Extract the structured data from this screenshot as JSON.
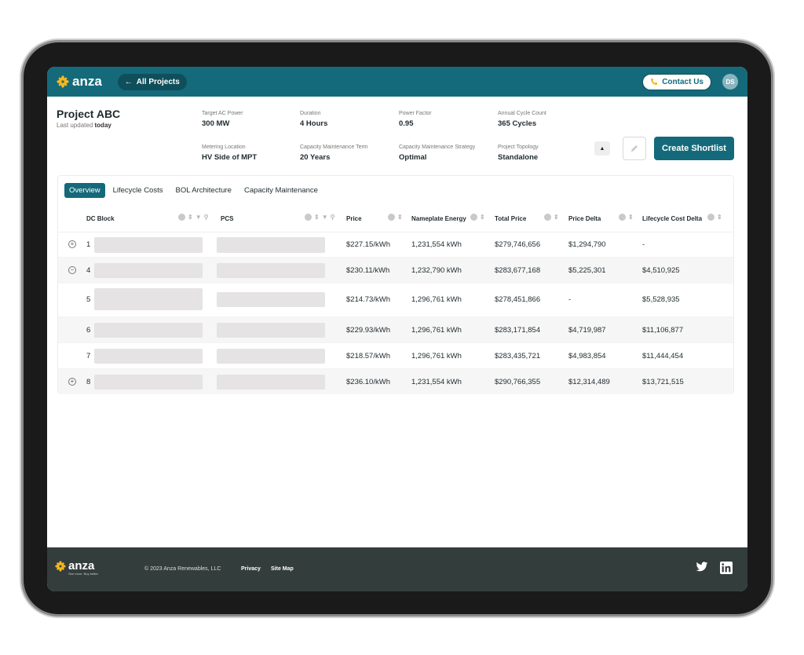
{
  "nav": {
    "logo_text": "anza",
    "back_label": "All Projects",
    "contact_label": "Contact Us",
    "avatar_initials": "DS"
  },
  "project": {
    "title": "Project ABC",
    "updated_prefix": "Last updated",
    "updated_value": "today",
    "meta": [
      {
        "label": "Target AC Power",
        "value": "300 MW"
      },
      {
        "label": "Duration",
        "value": "4 Hours"
      },
      {
        "label": "Power Factor",
        "value": "0.95"
      },
      {
        "label": "Annual Cycle Count",
        "value": "365 Cycles"
      },
      {
        "label": "Metering Location",
        "value": "HV Side of MPT"
      },
      {
        "label": "Capacity Maintenance Term",
        "value": "20 Years"
      },
      {
        "label": "Capacity Maintenance Strategy",
        "value": "Optimal"
      },
      {
        "label": "Project Topology",
        "value": "Standalone"
      }
    ],
    "shortlist_label": "Create Shortlist"
  },
  "tabs": [
    "Overview",
    "Lifecycle Costs",
    "BOL Architecture",
    "Capacity Maintenance"
  ],
  "table": {
    "columns": [
      "DC Block",
      "PCS",
      "Price",
      "Nameplate Energy",
      "Total Price",
      "Price Delta",
      "Lifecycle Cost Delta"
    ],
    "rows": [
      {
        "expander": "+",
        "id": "1",
        "price": "$227.15/kWh",
        "energy": "1,231,554 kWh",
        "total": "$279,746,656",
        "delta": "$1,294,790",
        "lifecycle": "-"
      },
      {
        "expander": "−",
        "id": "4",
        "price": "$230.11/kWh",
        "energy": "1,232,790 kWh",
        "total": "$283,677,168",
        "delta": "$5,225,301",
        "lifecycle": "$4,510,925"
      },
      {
        "expander": "",
        "id": "5",
        "price": "$214.73/kWh",
        "energy": "1,296,761 kWh",
        "total": "$278,451,866",
        "delta": "-",
        "lifecycle": "$5,528,935"
      },
      {
        "expander": "",
        "id": "6",
        "price": "$229.93/kWh",
        "energy": "1,296,761 kWh",
        "total": "$283,171,854",
        "delta": "$4,719,987",
        "lifecycle": "$11,106,877"
      },
      {
        "expander": "",
        "id": "7",
        "price": "$218.57/kWh",
        "energy": "1,296,761 kWh",
        "total": "$283,435,721",
        "delta": "$4,983,854",
        "lifecycle": "$11,444,454"
      },
      {
        "expander": "+",
        "id": "8",
        "price": "$236.10/kWh",
        "energy": "1,231,554 kWh",
        "total": "$290,766,355",
        "delta": "$12,314,489",
        "lifecycle": "$13,721,515"
      }
    ]
  },
  "footer": {
    "logo_text": "anza",
    "tagline": "See more. Buy better.",
    "copyright": "© 2023 Anza Renewables, LLC",
    "privacy": "Privacy",
    "sitemap": "Site Map"
  },
  "colors": {
    "primary": "#146a7a",
    "accent": "#f5b821",
    "footer": "#333d3c"
  },
  "icons": [
    "back-arrow-icon",
    "phone-icon",
    "pencil-icon",
    "caret-up-icon",
    "info-icon",
    "sort-icon",
    "filter-icon",
    "search-icon",
    "twitter-icon",
    "linkedin-icon"
  ]
}
